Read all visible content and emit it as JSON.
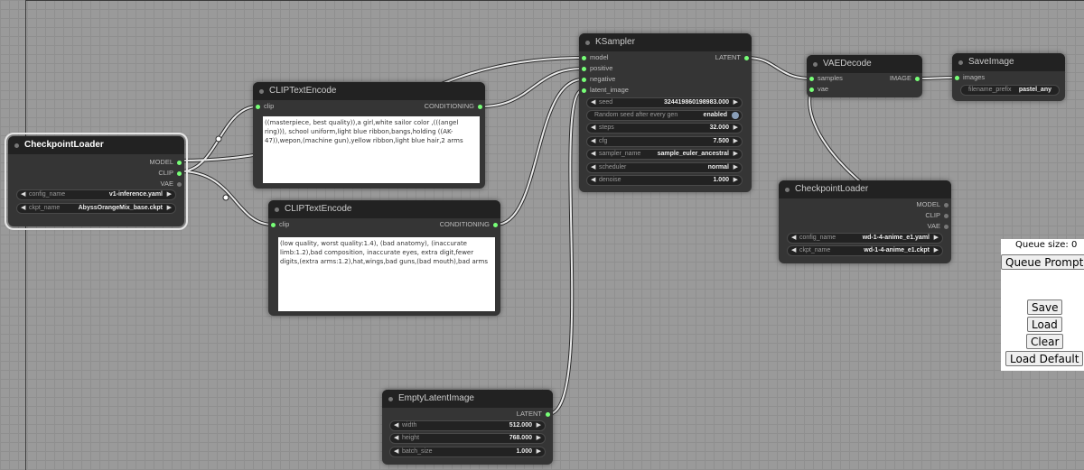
{
  "nodes": {
    "checkpoint_loader_1": {
      "title": "CheckpointLoader",
      "outputs": [
        "MODEL",
        "CLIP",
        "VAE"
      ],
      "widgets": [
        {
          "label": "config_name",
          "value": "v1-inference.yaml"
        },
        {
          "label": "ckpt_name",
          "value": "AbyssOrangeMix_base.ckpt"
        }
      ]
    },
    "clip_text_encode_pos": {
      "title": "CLIPTextEncode",
      "input": "clip",
      "output": "CONDITIONING",
      "text": "((masterpiece, best quality)),a girl,white sailor color ,(((angel ring))), school uniform,light blue ribbon,bangs,holding ((AK-47)),wepon,(machine gun),yellow ribbon,light blue hair,2 arms"
    },
    "clip_text_encode_neg": {
      "title": "CLIPTextEncode",
      "input": "clip",
      "output": "CONDITIONING",
      "text": "(low quality, worst quality:1.4), (bad anatomy), (inaccurate limb:1.2),bad composition, inaccurate eyes, extra digit,fewer digits,(extra arms:1.2),hat,wings,bad guns,(bad mouth),bad arms"
    },
    "ksampler": {
      "title": "KSampler",
      "inputs": [
        "model",
        "positive",
        "negative",
        "latent_image"
      ],
      "output": "LATENT",
      "widgets": [
        {
          "label": "seed",
          "value": "324419860198983.000"
        },
        {
          "label": "Random seed after every gen",
          "value": "enabled"
        },
        {
          "label": "steps",
          "value": "32.000"
        },
        {
          "label": "cfg",
          "value": "7.500"
        },
        {
          "label": "sampler_name",
          "value": "sample_euler_ancestral"
        },
        {
          "label": "scheduler",
          "value": "normal"
        },
        {
          "label": "denoise",
          "value": "1.000"
        }
      ]
    },
    "vae_decode": {
      "title": "VAEDecode",
      "inputs": [
        "samples",
        "vae"
      ],
      "output": "IMAGE"
    },
    "save_image": {
      "title": "SaveImage",
      "input": "images",
      "widget": {
        "label": "filename_prefix",
        "value": "pastel_any"
      }
    },
    "checkpoint_loader_2": {
      "title": "CheckpointLoader",
      "outputs": [
        "MODEL",
        "CLIP",
        "VAE"
      ],
      "widgets": [
        {
          "label": "config_name",
          "value": "wd-1-4-anime_e1.yaml"
        },
        {
          "label": "ckpt_name",
          "value": "wd-1-4-anime_e1.ckpt"
        }
      ]
    },
    "empty_latent": {
      "title": "EmptyLatentImage",
      "output": "LATENT",
      "widgets": [
        {
          "label": "width",
          "value": "512.000"
        },
        {
          "label": "height",
          "value": "768.000"
        },
        {
          "label": "batch_size",
          "value": "1.000"
        }
      ]
    }
  },
  "queue_panel": {
    "queue_size_label": "Queue size: 0",
    "queue_prompt_label": "Queue Prompt",
    "save_label": "Save",
    "load_label": "Load",
    "clear_label": "Clear",
    "load_default_label": "Load Default"
  },
  "colors": {
    "canvas": "#9a9a9a",
    "node_body": "#353535",
    "node_title": "#222222",
    "connected_pin": "#77ff77",
    "link": "#e8e8e8"
  }
}
